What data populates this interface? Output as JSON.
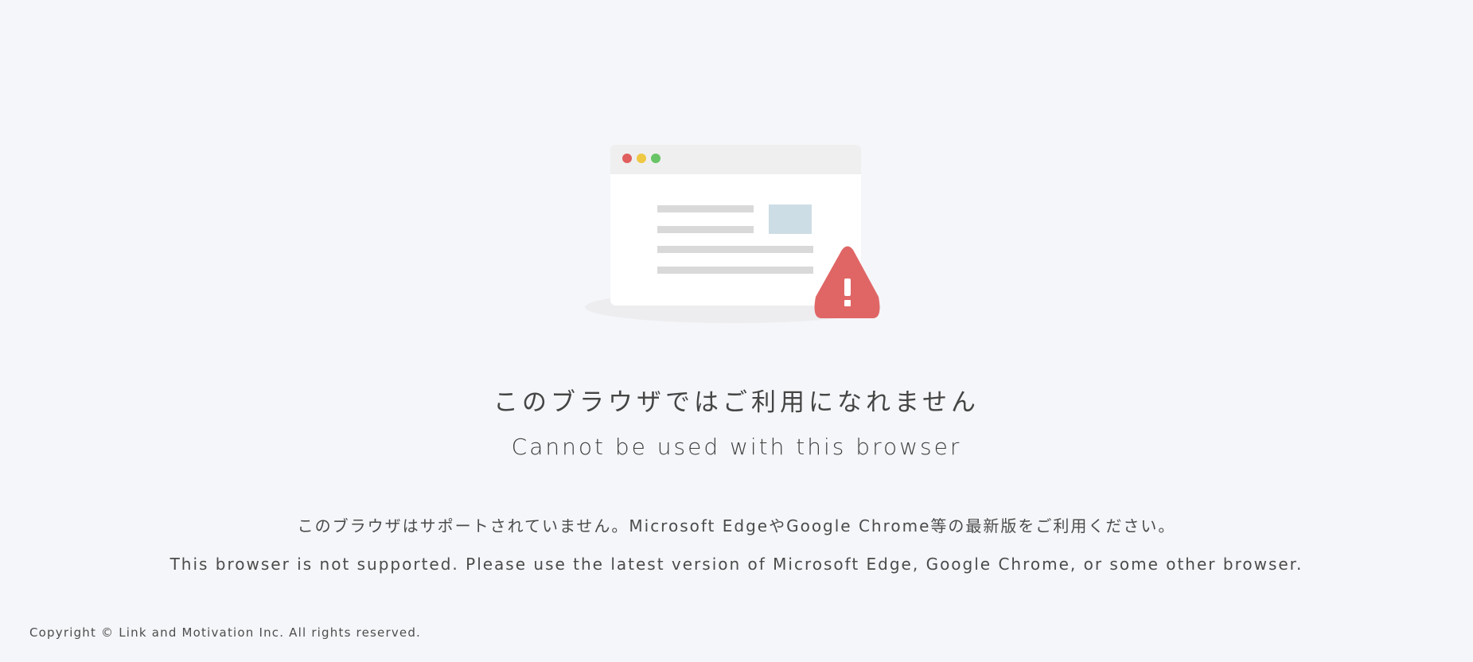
{
  "illustration": {
    "icon": "browser-warning-icon",
    "colors": {
      "window_bg": "#ffffff",
      "titlebar_bg": "#efefef",
      "dot_red": "#e05e5d",
      "dot_yellow": "#efc844",
      "dot_green": "#68c466",
      "line": "#d9d9d9",
      "image_block": "#cddde5",
      "warning": "#e06666",
      "warning_mark": "#ffffff",
      "shadow": "#ededf0"
    }
  },
  "heading": {
    "ja": "このブラウザではご利用になれません",
    "en": "Cannot be used with this browser"
  },
  "message": {
    "ja": "このブラウザはサポートされていません。Microsoft EdgeやGoogle Chrome等の最新版をご利用ください。",
    "en": "This browser is not supported. Please use the latest version of Microsoft Edge, Google Chrome, or some other browser."
  },
  "footer": {
    "copyright": "Copyright © Link and Motivation Inc. All rights reserved."
  }
}
